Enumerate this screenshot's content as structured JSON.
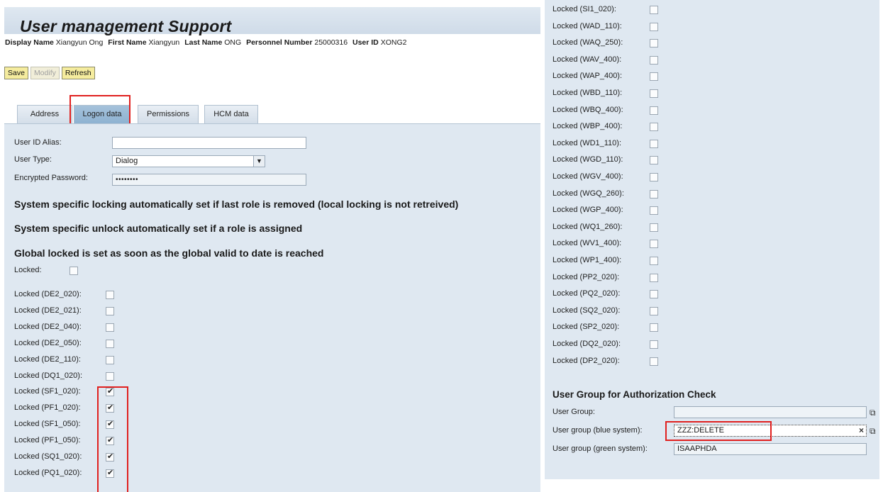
{
  "header": {
    "title": "User management Support",
    "info": [
      {
        "label": "Display Name",
        "value": "Xiangyun Ong"
      },
      {
        "label": "First Name",
        "value": "Xiangyun"
      },
      {
        "label": "Last Name",
        "value": "ONG"
      },
      {
        "label": "Personnel Number",
        "value": "25000316"
      },
      {
        "label": "User ID",
        "value": "XONG2"
      }
    ]
  },
  "toolbar": {
    "save": "Save",
    "modify": "Modify",
    "refresh": "Refresh"
  },
  "tabs": [
    "Address",
    "Logon data",
    "Permissions",
    "HCM data"
  ],
  "active_tab": "Logon data",
  "form": {
    "alias_label": "User ID Alias:",
    "alias_value": "",
    "type_label": "User Type:",
    "type_value": "Dialog",
    "pwd_label": "Encrypted Password:",
    "pwd_value": "••••••••",
    "note1": "System specific locking automatically set if last role is removed (local locking is not retreived)",
    "note2": "System specific unlock automatically set if a role is assigned",
    "note3": "Global locked is set as soon as the global valid to date is reached",
    "locked_label": "Locked:"
  },
  "left_locks": [
    {
      "label": "Locked (DE2_020):",
      "checked": false
    },
    {
      "label": "Locked (DE2_021):",
      "checked": false
    },
    {
      "label": "Locked (DE2_040):",
      "checked": false
    },
    {
      "label": "Locked (DE2_050):",
      "checked": false
    },
    {
      "label": "Locked (DE2_110):",
      "checked": false
    },
    {
      "label": "Locked (DQ1_020):",
      "checked": false
    },
    {
      "label": "Locked (SF1_020):",
      "checked": true
    },
    {
      "label": "Locked (PF1_020):",
      "checked": true
    },
    {
      "label": "Locked (SF1_050):",
      "checked": true
    },
    {
      "label": "Locked (PF1_050):",
      "checked": true
    },
    {
      "label": "Locked (SQ1_020):",
      "checked": true
    },
    {
      "label": "Locked (PQ1_020):",
      "checked": true
    }
  ],
  "right_locks": [
    {
      "label": "Locked (SI1_020):",
      "checked": false
    },
    {
      "label": "Locked (WAD_110):",
      "checked": false
    },
    {
      "label": "Locked (WAQ_250):",
      "checked": false
    },
    {
      "label": "Locked (WAV_400):",
      "checked": false
    },
    {
      "label": "Locked (WAP_400):",
      "checked": false
    },
    {
      "label": "Locked (WBD_110):",
      "checked": false
    },
    {
      "label": "Locked (WBQ_400):",
      "checked": false
    },
    {
      "label": "Locked (WBP_400):",
      "checked": false
    },
    {
      "label": "Locked (WD1_110):",
      "checked": false
    },
    {
      "label": "Locked (WGD_110):",
      "checked": false
    },
    {
      "label": "Locked (WGV_400):",
      "checked": false
    },
    {
      "label": "Locked (WGQ_260):",
      "checked": false
    },
    {
      "label": "Locked (WGP_400):",
      "checked": false
    },
    {
      "label": "Locked (WQ1_260):",
      "checked": false
    },
    {
      "label": "Locked (WV1_400):",
      "checked": false
    },
    {
      "label": "Locked (WP1_400):",
      "checked": false
    },
    {
      "label": "Locked (PP2_020):",
      "checked": false
    },
    {
      "label": "Locked (PQ2_020):",
      "checked": false
    },
    {
      "label": "Locked (SQ2_020):",
      "checked": false
    },
    {
      "label": "Locked (SP2_020):",
      "checked": false
    },
    {
      "label": "Locked (DQ2_020):",
      "checked": false
    },
    {
      "label": "Locked (DP2_020):",
      "checked": false
    }
  ],
  "user_group": {
    "heading": "User Group for Authorization Check",
    "group_label": "User Group:",
    "group_value": "",
    "blue_label": "User group (blue system):",
    "blue_value": "ZZZ:DELETE",
    "green_label": "User group (green system):",
    "green_value": "ISAAPHDA"
  },
  "colors": {
    "highlight": "#e0201f",
    "panel": "#dfe8f1",
    "button": "#f5ec9e"
  }
}
